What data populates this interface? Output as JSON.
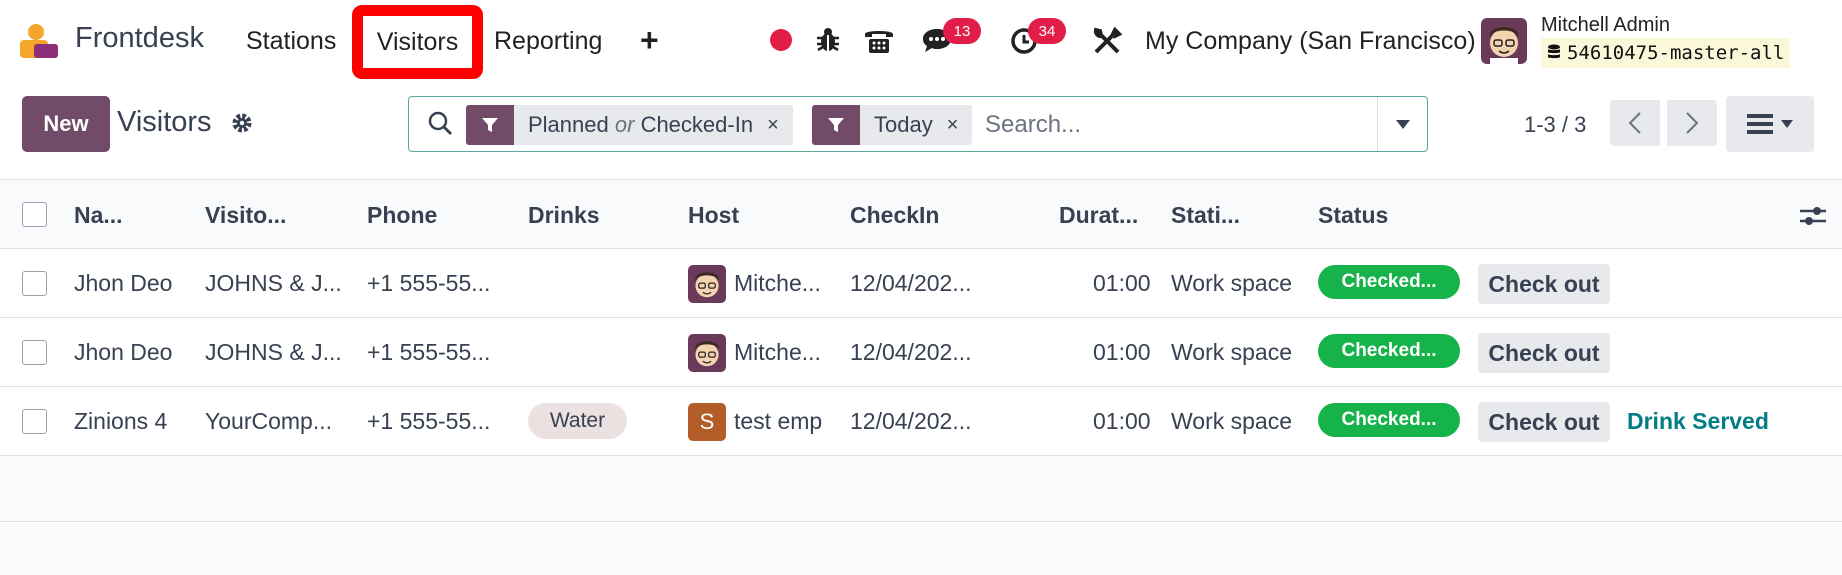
{
  "navbar": {
    "app_name": "Frontdesk",
    "menus": [
      "Stations",
      "Visitors",
      "Reporting"
    ],
    "plus_label": "+",
    "chat_badge": "13",
    "activity_badge": "34",
    "company": "My Company (San Francisco)",
    "user_name": "Mitchell Admin",
    "db_name": "54610475-master-all",
    "highlight_color": "#ff0000"
  },
  "control_panel": {
    "new_label": "New",
    "title": "Visitors",
    "facets": [
      {
        "part1": "Planned",
        "or": "or",
        "part2": "Checked-In",
        "close": "×"
      },
      {
        "label": "Today",
        "close": "×"
      }
    ],
    "search_placeholder": "Search...",
    "pager": "1-3 / 3"
  },
  "table": {
    "headers": [
      "Na...",
      "Visito...",
      "Phone",
      "Drinks",
      "Host",
      "CheckIn",
      "Durat...",
      "Stati...",
      "Status"
    ],
    "rows": [
      {
        "name": "Jhon Deo",
        "company": "JOHNS & J...",
        "phone": "+1 555-55...",
        "drinks": "",
        "host": "Mitche...",
        "checkin": "12/04/202...",
        "duration": "01:00",
        "station": "Work space",
        "status": "Checked...",
        "action": "Check out",
        "extra": ""
      },
      {
        "name": "Jhon Deo",
        "company": "JOHNS & J...",
        "phone": "+1 555-55...",
        "drinks": "",
        "host": "Mitche...",
        "checkin": "12/04/202...",
        "duration": "01:00",
        "station": "Work space",
        "status": "Checked...",
        "action": "Check out",
        "extra": ""
      },
      {
        "name": "Zinions 4",
        "company": "YourComp...",
        "phone": "+1 555-55...",
        "drinks": "Water",
        "host": "test emp",
        "host_initial": "S",
        "checkin": "12/04/202...",
        "duration": "01:00",
        "station": "Work space",
        "status": "Checked...",
        "action": "Check out",
        "extra": "Drink Served"
      }
    ]
  },
  "colors": {
    "brand": "#714b67",
    "status_green": "#16b34a",
    "teal": "#017e84",
    "badge_red": "#e11d48"
  }
}
